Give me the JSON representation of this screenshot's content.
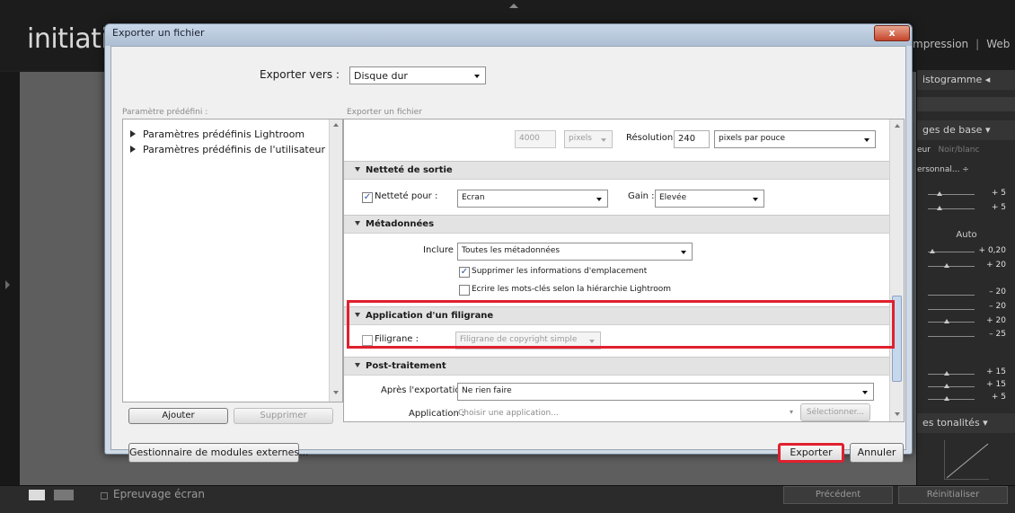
{
  "lightroom": {
    "logo": "initiatio",
    "modules": [
      "mpression",
      "Web"
    ],
    "right_panel": {
      "histogram_label": "istogramme",
      "basic_label": "ges de base",
      "color_label": "eur",
      "bw_label": "Noir/blanc",
      "profile_label": "ersonnal... ÷",
      "values_a": [
        "+ 5",
        "+ 5"
      ],
      "auto_label": "Auto",
      "values_b": [
        "+ 0,20",
        "+ 20"
      ],
      "values_c": [
        "– 20",
        "– 20",
        "+ 20",
        "– 25"
      ],
      "values_d": [
        "+ 15",
        "+ 15",
        "+ 5"
      ],
      "tone_label": "es tonalités"
    },
    "bottom": {
      "soft_proof": "Epreuvage écran",
      "previous_button": "Précédent",
      "reset_button": "Réinitialiser"
    }
  },
  "dialog": {
    "title": "Exporter un fichier",
    "close_glyph": "x",
    "export_to_label": "Exporter vers :",
    "export_to_value": "Disque dur",
    "presets_label": "Paramètre prédéfini :",
    "settings_caption": "Exporter un fichier",
    "presets": [
      "Paramètres prédéfinis Lightroom",
      "Paramètres prédéfinis de l'utilisateur"
    ],
    "add_button": "Ajouter",
    "remove_button": "Supprimer",
    "plugin_manager_button": "Gestionnaire de modules externes...",
    "export_button": "Exporter",
    "cancel_button": "Annuler",
    "sizing": {
      "width_value": "4000",
      "unit": "pixels",
      "resolution_label": "Résolution :",
      "resolution_value": "240",
      "resolution_unit": "pixels par pouce"
    },
    "sharpening": {
      "header": "Netteté de sortie",
      "checkbox_label": "Netteté pour :",
      "checkbox_checked": true,
      "target": "Ecran",
      "gain_label": "Gain :",
      "gain_value": "Elevée"
    },
    "metadata": {
      "header": "Métadonnées",
      "include_label": "Inclure :",
      "include_value": "Toutes les métadonnées",
      "remove_location_label": "Supprimer les informations d'emplacement",
      "remove_location_checked": true,
      "hierarchy_label": "Ecrire les mots-clés selon la hiérarchie Lightroom",
      "hierarchy_checked": false
    },
    "watermark": {
      "header": "Application d'un filigrane",
      "checkbox_label": "Filigrane :",
      "checkbox_checked": false,
      "value": "Filigrane de copyright simple"
    },
    "post_processing": {
      "header": "Post-traitement",
      "after_label": "Après l'exportation :",
      "after_value": "Ne rien faire",
      "application_label": "Application :",
      "application_placeholder": "Choisir une application...",
      "choose_button": "Sélectionner..."
    }
  },
  "colors": {
    "highlight": "#e0202e",
    "dialog_frame": "#cfdae6"
  }
}
